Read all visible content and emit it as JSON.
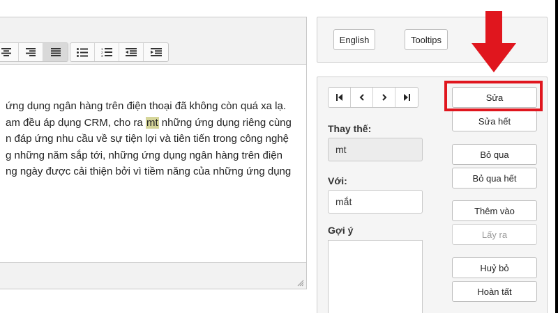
{
  "editor": {
    "text_lines": [
      "ứng dụng ngân hàng trên điện thoại đã không còn quá xa lạ.",
      "am đều áp dụng CRM, cho ra ",
      "n đáp ứng nhu cầu về sự tiện lợi và tiên tiến trong công nghệ",
      "g những năm sắp tới, những ứng dụng ngân hàng trên điện",
      "ng ngày được cải thiện bởi vì tiềm năng của những ứng dụng"
    ],
    "highlight_word": "mt",
    "line2_after": " những ứng dụng riêng cùng",
    "toolbar_icons": [
      "align-center-icon",
      "align-right-icon",
      "align-justify-icon",
      "bullet-list-icon",
      "numbered-list-icon",
      "outdent-icon",
      "indent-icon"
    ]
  },
  "lang_panel": {
    "english_label": "English",
    "tooltips_label": "Tooltips"
  },
  "spell": {
    "nav_icons": [
      "first-icon",
      "prev-icon",
      "next-icon",
      "last-icon"
    ],
    "replace_label": "Thay thế:",
    "replace_value": "mt",
    "with_label": "Với:",
    "with_value": "mắt",
    "suggest_label": "Gợi ý",
    "buttons": {
      "fix": "Sửa",
      "fix_all": "Sửa hết",
      "skip": "Bỏ qua",
      "skip_all": "Bỏ qua hết",
      "add": "Thêm vào",
      "remove": "Lấy ra",
      "cancel": "Huỷ bỏ",
      "done": "Hoàn tất"
    }
  },
  "colors": {
    "annotation_red": "#e0161e",
    "highlight": "#d6d69a"
  }
}
